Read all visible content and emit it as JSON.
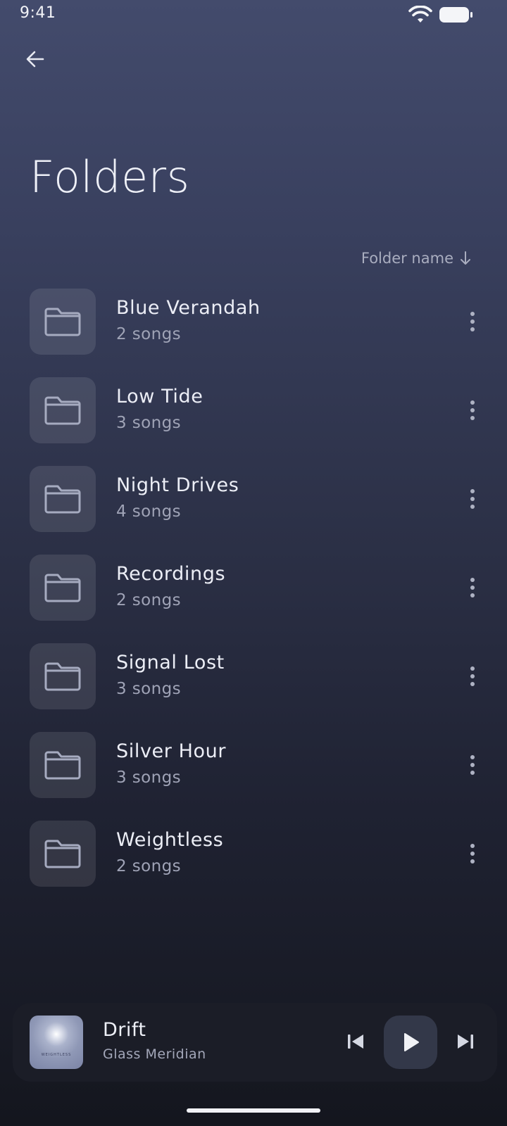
{
  "status_bar": {
    "time": "9:41"
  },
  "header": {
    "title": "Folders"
  },
  "sort": {
    "label": "Folder name"
  },
  "folders": [
    {
      "name": "Blue Verandah",
      "count": "2 songs"
    },
    {
      "name": "Low Tide",
      "count": "3 songs"
    },
    {
      "name": "Night Drives",
      "count": "4 songs"
    },
    {
      "name": "Recordings",
      "count": "2 songs"
    },
    {
      "name": "Signal Lost",
      "count": "3 songs"
    },
    {
      "name": "Silver Hour",
      "count": "3 songs"
    },
    {
      "name": "Weightless",
      "count": "2 songs"
    }
  ],
  "now_playing": {
    "title": "Drift",
    "artist": "Glass Meridian",
    "album_art_text": "WEIGHTLESS"
  },
  "colors": {
    "background_top": "#434b6c",
    "background_bottom": "#14161e",
    "tile": "#4a5068",
    "player_bg": "#1b1d27"
  },
  "icons": {
    "back": "arrow-left-icon",
    "sort": "arrow-down-icon",
    "folder": "folder-icon",
    "more": "more-vertical-icon",
    "previous": "skip-previous-icon",
    "play": "play-icon",
    "next": "skip-next-icon"
  }
}
